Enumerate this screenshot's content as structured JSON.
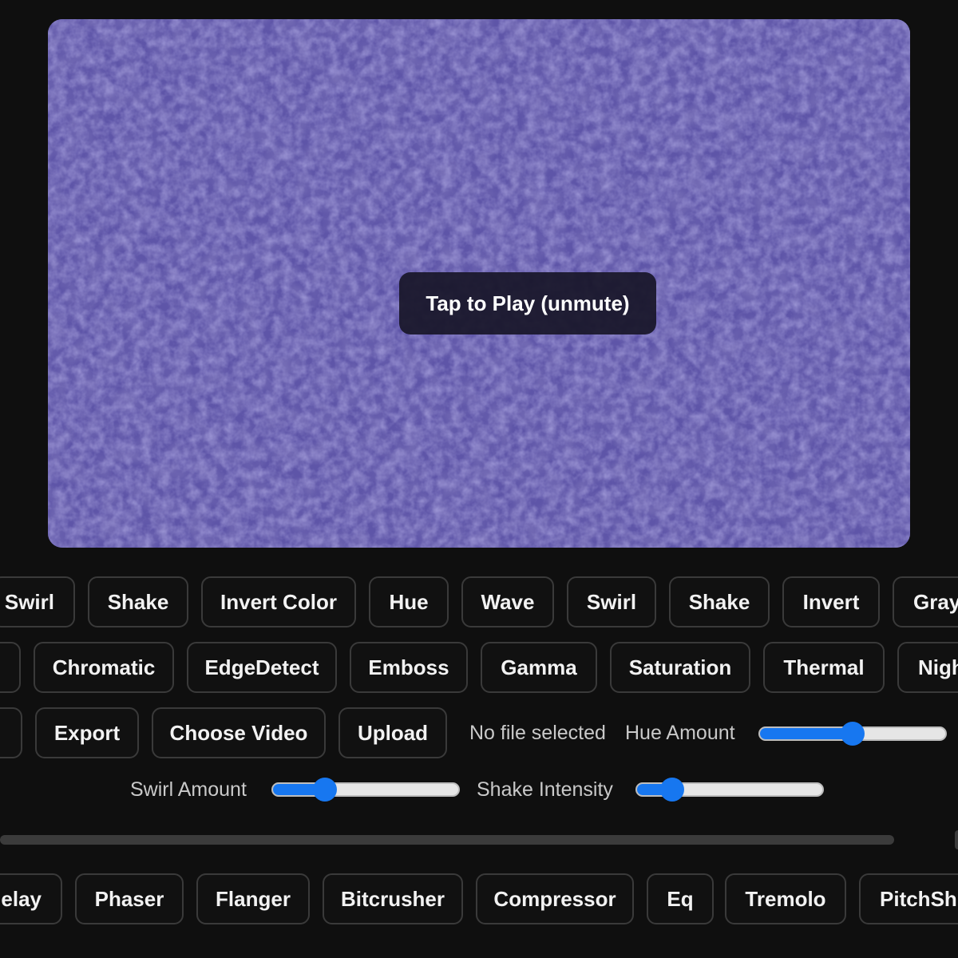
{
  "video": {
    "overlay_label": "Tap to Play (unmute)"
  },
  "row1": {
    "chips": [
      "Swirl",
      "Shake",
      "Invert Color",
      "Hue",
      "Wave",
      "Swirl",
      "Shake",
      "Invert",
      "Gray"
    ]
  },
  "row2": {
    "chips": [
      "Chromatic",
      "EdgeDetect",
      "Emboss",
      "Gamma",
      "Saturation",
      "Thermal",
      "Nigh"
    ]
  },
  "row3": {
    "export_label": "Export",
    "choose_video_label": "Choose Video",
    "upload_label": "Upload",
    "file_status": "No file selected",
    "hue_amount_label": "Hue Amount",
    "hue_amount_value": 0.5
  },
  "row4": {
    "swirl_amount_label": "Swirl Amount",
    "swirl_amount_value": 0.28,
    "shake_intensity_label": "Shake Intensity",
    "shake_intensity_value": 0.19
  },
  "audio": {
    "chips": [
      "elay",
      "Phaser",
      "Flanger",
      "Bitcrusher",
      "Compressor",
      "Eq",
      "Tremolo",
      "PitchShi"
    ]
  },
  "colors": {
    "accent": "#1777f0",
    "video_base": "#5e55a8",
    "background": "#0f0f0f"
  }
}
